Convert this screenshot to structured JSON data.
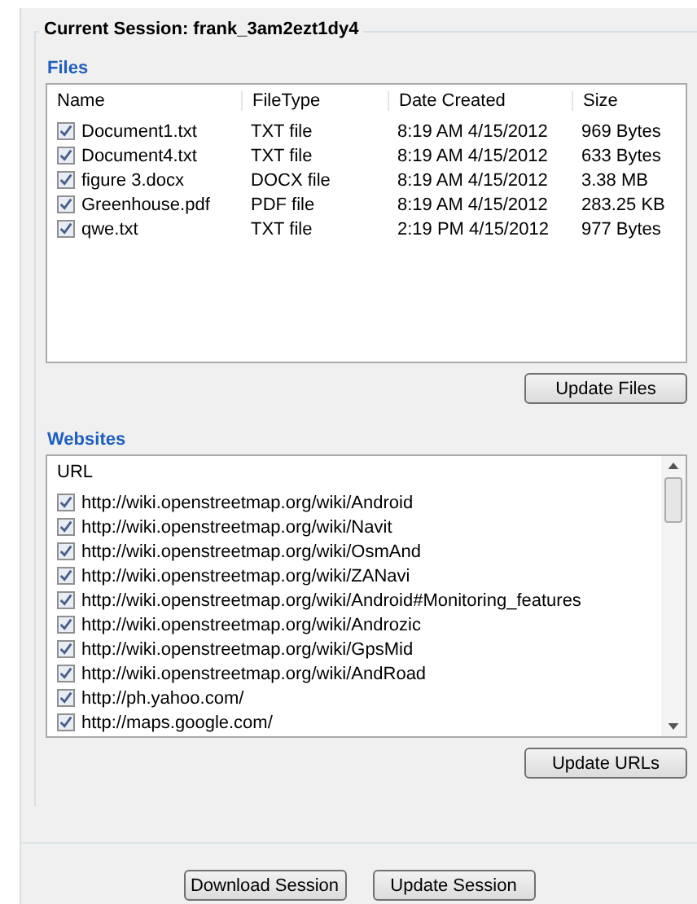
{
  "session": {
    "title": "Current Session: frank_3am2ezt1dy4"
  },
  "files": {
    "label": "Files",
    "columns": [
      "Name",
      "FileType",
      "Date Created",
      "Size"
    ],
    "rows": [
      {
        "checked": true,
        "cells": [
          "Document1.txt",
          "TXT file",
          "8:19 AM 4/15/2012",
          "969 Bytes"
        ]
      },
      {
        "checked": true,
        "cells": [
          "Document4.txt",
          "TXT file",
          "8:19 AM 4/15/2012",
          "633 Bytes"
        ]
      },
      {
        "checked": true,
        "cells": [
          "figure 3.docx",
          "DOCX file",
          "8:19 AM 4/15/2012",
          "3.38 MB"
        ]
      },
      {
        "checked": true,
        "cells": [
          "Greenhouse.pdf",
          "PDF file",
          "8:19 AM 4/15/2012",
          "283.25 KB"
        ]
      },
      {
        "checked": true,
        "cells": [
          "qwe.txt",
          "TXT file",
          "2:19 PM 4/15/2012",
          "977 Bytes"
        ]
      }
    ],
    "button": "Update Files"
  },
  "websites": {
    "label": "Websites",
    "column": "URL",
    "rows": [
      {
        "checked": true,
        "url": "http://wiki.openstreetmap.org/wiki/Android"
      },
      {
        "checked": true,
        "url": "http://wiki.openstreetmap.org/wiki/Navit"
      },
      {
        "checked": true,
        "url": "http://wiki.openstreetmap.org/wiki/OsmAnd"
      },
      {
        "checked": true,
        "url": "http://wiki.openstreetmap.org/wiki/ZANavi"
      },
      {
        "checked": true,
        "url": "http://wiki.openstreetmap.org/wiki/Android#Monitoring_features"
      },
      {
        "checked": true,
        "url": "http://wiki.openstreetmap.org/wiki/Androzic"
      },
      {
        "checked": true,
        "url": "http://wiki.openstreetmap.org/wiki/GpsMid"
      },
      {
        "checked": true,
        "url": "http://wiki.openstreetmap.org/wiki/AndRoad"
      },
      {
        "checked": true,
        "url": "http://ph.yahoo.com/"
      },
      {
        "checked": true,
        "url": "http://maps.google.com/"
      }
    ],
    "button": "Update URLs"
  },
  "footer_buttons": [
    "Download Session",
    "Update Session"
  ]
}
